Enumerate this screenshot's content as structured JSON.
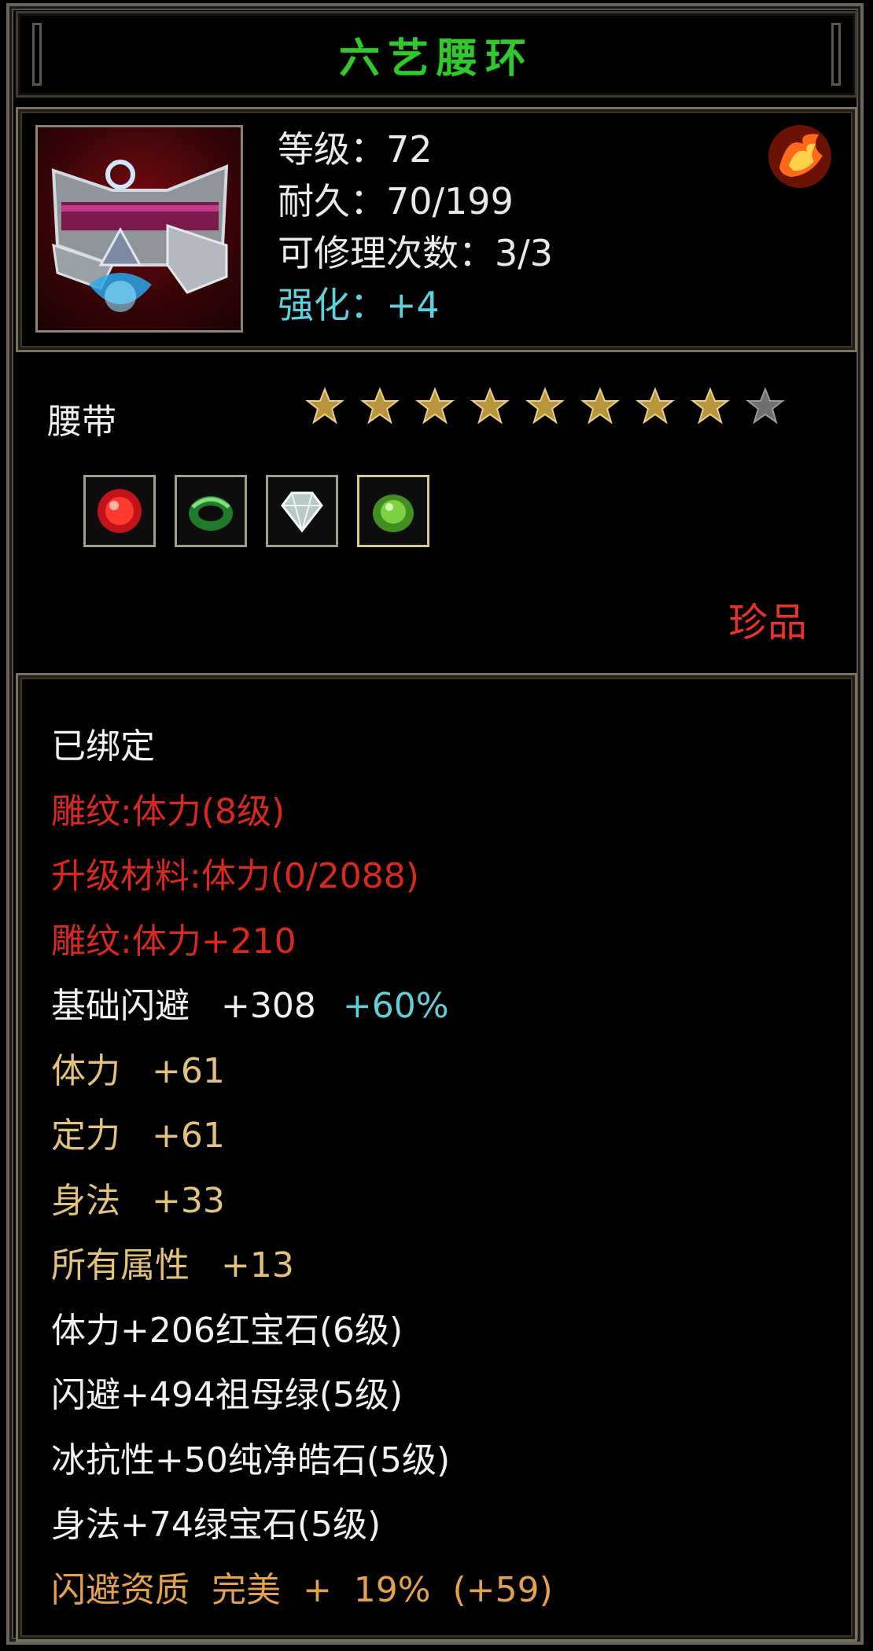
{
  "item": {
    "name": "六艺腰环",
    "level_line": "等级：72",
    "durability_line": "耐久：70/199",
    "repairs_line": "可修理次数：3/3",
    "enhance_line": "强化：+4",
    "slot_type": "腰带",
    "stars_total": 9,
    "stars_filled": 8,
    "rarity": "珍品"
  },
  "gems": [
    {
      "name": "red-gem-icon",
      "color": "#d61f1f"
    },
    {
      "name": "green-ring-gem-icon",
      "color": "#2f9a3a"
    },
    {
      "name": "white-diamond-gem-icon",
      "color": "#c9d8d8"
    },
    {
      "name": "green-crystal-gem-icon",
      "color": "#6ac03a"
    }
  ],
  "stats": {
    "bound": "已绑定",
    "engrave_1": "雕纹:体力(8级)",
    "upgrade_material": "升级材料:体力(0/2088)",
    "engrave_2": "雕纹:体力+210",
    "base_dodge_label": "基础闪避",
    "base_dodge_value": "+308",
    "base_dodge_bonus": "+60%",
    "stamina_label": "体力",
    "stamina_value": "+61",
    "focus_label": "定力",
    "focus_value": "+61",
    "agility_label": "身法",
    "agility_value": "+33",
    "all_attr_label": "所有属性",
    "all_attr_value": "+13",
    "gem_line_1": "体力+206红宝石(6级)",
    "gem_line_2": "闪避+494祖母绿(5级)",
    "gem_line_3": "冰抗性+50纯净皓石(5级)",
    "gem_line_4": "身法+74绿宝石(5级)",
    "quality_line": "闪避资质  完美  +  19%  (+59)"
  },
  "colors": {
    "title": "#31c92b",
    "red_text": "#d9291f",
    "gold_text": "#e3c37a",
    "cyan_text": "#62cfd6",
    "orange_text": "#e3a24a",
    "star_gold": "#b8943c",
    "star_gray": "#6e6e6e"
  }
}
